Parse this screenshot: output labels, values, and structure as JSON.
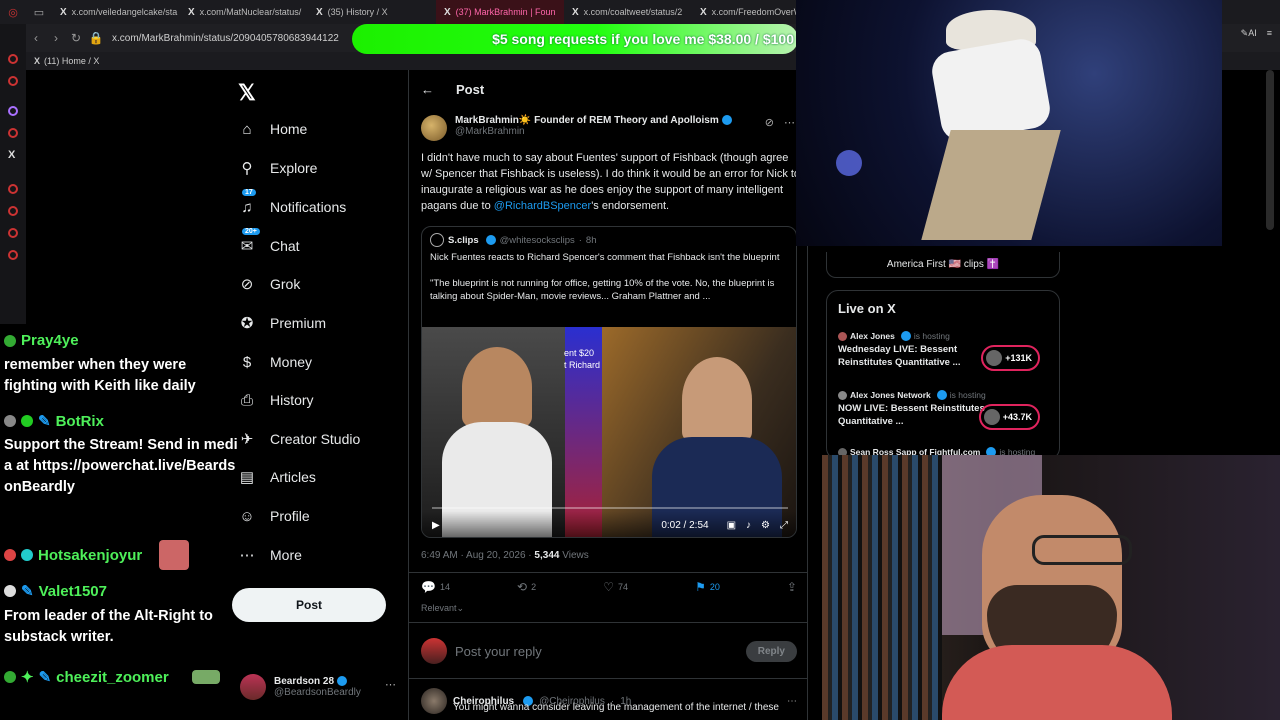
{
  "browser": {
    "tabs": [
      {
        "label": "x.com/veiledangelcake/sta",
        "active": false
      },
      {
        "label": "x.com/MatNuclear/status/",
        "active": false
      },
      {
        "label": "(35) History / X",
        "active": false
      },
      {
        "label": "(37) MarkBrahmin | Foun",
        "active": true
      },
      {
        "label": "x.com/coaltweet/status/2",
        "active": false
      },
      {
        "label": "x.com/FreedomOverWe",
        "active": false
      }
    ],
    "url": "x.com/MarkBrahmin/status/2090405780683944122",
    "bookmark": "(11) Home / X",
    "ai_label": "AI"
  },
  "donation_banner": "$5 song requests if you love me $38.00 / $100",
  "nav": {
    "items": [
      {
        "label": "Home",
        "icon": "home-icon",
        "glyph": "⌂"
      },
      {
        "label": "Explore",
        "icon": "search-icon",
        "glyph": "⚲"
      },
      {
        "label": "Notifications",
        "icon": "bell-icon",
        "glyph": "🔔",
        "badge": "17"
      },
      {
        "label": "Chat",
        "icon": "chat-icon",
        "glyph": "✉",
        "badge": "20+"
      },
      {
        "label": "Grok",
        "icon": "grok-icon",
        "glyph": "⊘"
      },
      {
        "label": "Premium",
        "icon": "premium-icon",
        "glyph": "✪"
      },
      {
        "label": "Money",
        "icon": "money-icon",
        "glyph": "$"
      },
      {
        "label": "History",
        "icon": "bookmark-icon",
        "glyph": "⎙"
      },
      {
        "label": "Creator Studio",
        "icon": "rocket-icon",
        "glyph": "✈"
      },
      {
        "label": "Articles",
        "icon": "articles-icon",
        "glyph": "▤"
      },
      {
        "label": "Profile",
        "icon": "profile-icon",
        "glyph": "☺"
      },
      {
        "label": "More",
        "icon": "more-icon",
        "glyph": "⋯"
      }
    ],
    "post_button": "Post",
    "account": {
      "name": "Beardson 28",
      "handle": "@BeardsonBeardly"
    }
  },
  "chat": [
    {
      "user": "Pray4ye",
      "message": "remember when they were fighting with Keith like daily"
    },
    {
      "user": "BotRix",
      "message": "Support the Stream! Send in media at https://powerchat.live/BeardsonBeardly"
    },
    {
      "user": "Hotsakenjoyur",
      "message": ""
    },
    {
      "user": "Valet1507",
      "message": "From leader of the Alt-Right to substack writer."
    },
    {
      "user": "cheezit_zoomer",
      "message": ""
    }
  ],
  "post": {
    "header": "Post",
    "author": "MarkBrahmin☀️ Founder of REM Theory and Apolloism",
    "handle": "@MarkBrahmin",
    "text_before": "I didn't have much to say about Fuentes' support of Fishback (though agree w/ Spencer that Fishback is useless). I do think it would be an error for Nick to inaugurate a religious war as he does enjoy the support of many intelligent pagans due to ",
    "mention": "@RichardBSpencer",
    "text_after": "'s endorsement.",
    "quote": {
      "name": "S.clips",
      "handle": "@whitesocksclips",
      "time": "8h",
      "line1": "Nick Fuentes reacts to Richard Spencer's comment that Fishback isn't the blueprint",
      "line2": "\"The blueprint is not running for office, getting 10% of the vote. No, the blueprint is talking about Spider-Man, movie reviews... Graham Plattner and ...",
      "overlay_line1": "ent $20",
      "overlay_line2": "t Richard",
      "video_time": "0:02 / 2:54"
    },
    "timestamp": "6:49 AM · Aug 20, 2026 · ",
    "views": "5,344",
    "views_label": " Views",
    "replies": "14",
    "reposts": "2",
    "likes": "74",
    "bookmarks": "20",
    "sort": "Relevant",
    "reply_placeholder": "Post your reply",
    "reply_button": "Reply",
    "next": {
      "name": "Cheirophilus",
      "handle": "@Cheirophilus",
      "time": "1h",
      "text": "You might wanna consider leaving the management of the internet / these"
    }
  },
  "sidebar": {
    "sponsor": "America First 🇺🇸 clips ✝️",
    "live_title": "Live on X",
    "live": [
      {
        "host": "Alex Jones",
        "status": "is hosting",
        "title": "Wednesday LIVE: Bessent Reinstitutes Quantitative ...",
        "count": "+131K"
      },
      {
        "host": "Alex Jones Network",
        "status": "is hosting",
        "title": "NOW LIVE: Bessent Reinstitutes Quantitative ...",
        "count": "+43.7K"
      },
      {
        "host": "Sean Ross Sapp of Fightful.com",
        "status": "is hosting",
        "title": "",
        "count": ""
      }
    ]
  },
  "colors": {
    "accent": "#1d9bf0",
    "chat_name": "#4ef05a",
    "live_pill": "#e0245e",
    "banner": "#1cf000"
  }
}
